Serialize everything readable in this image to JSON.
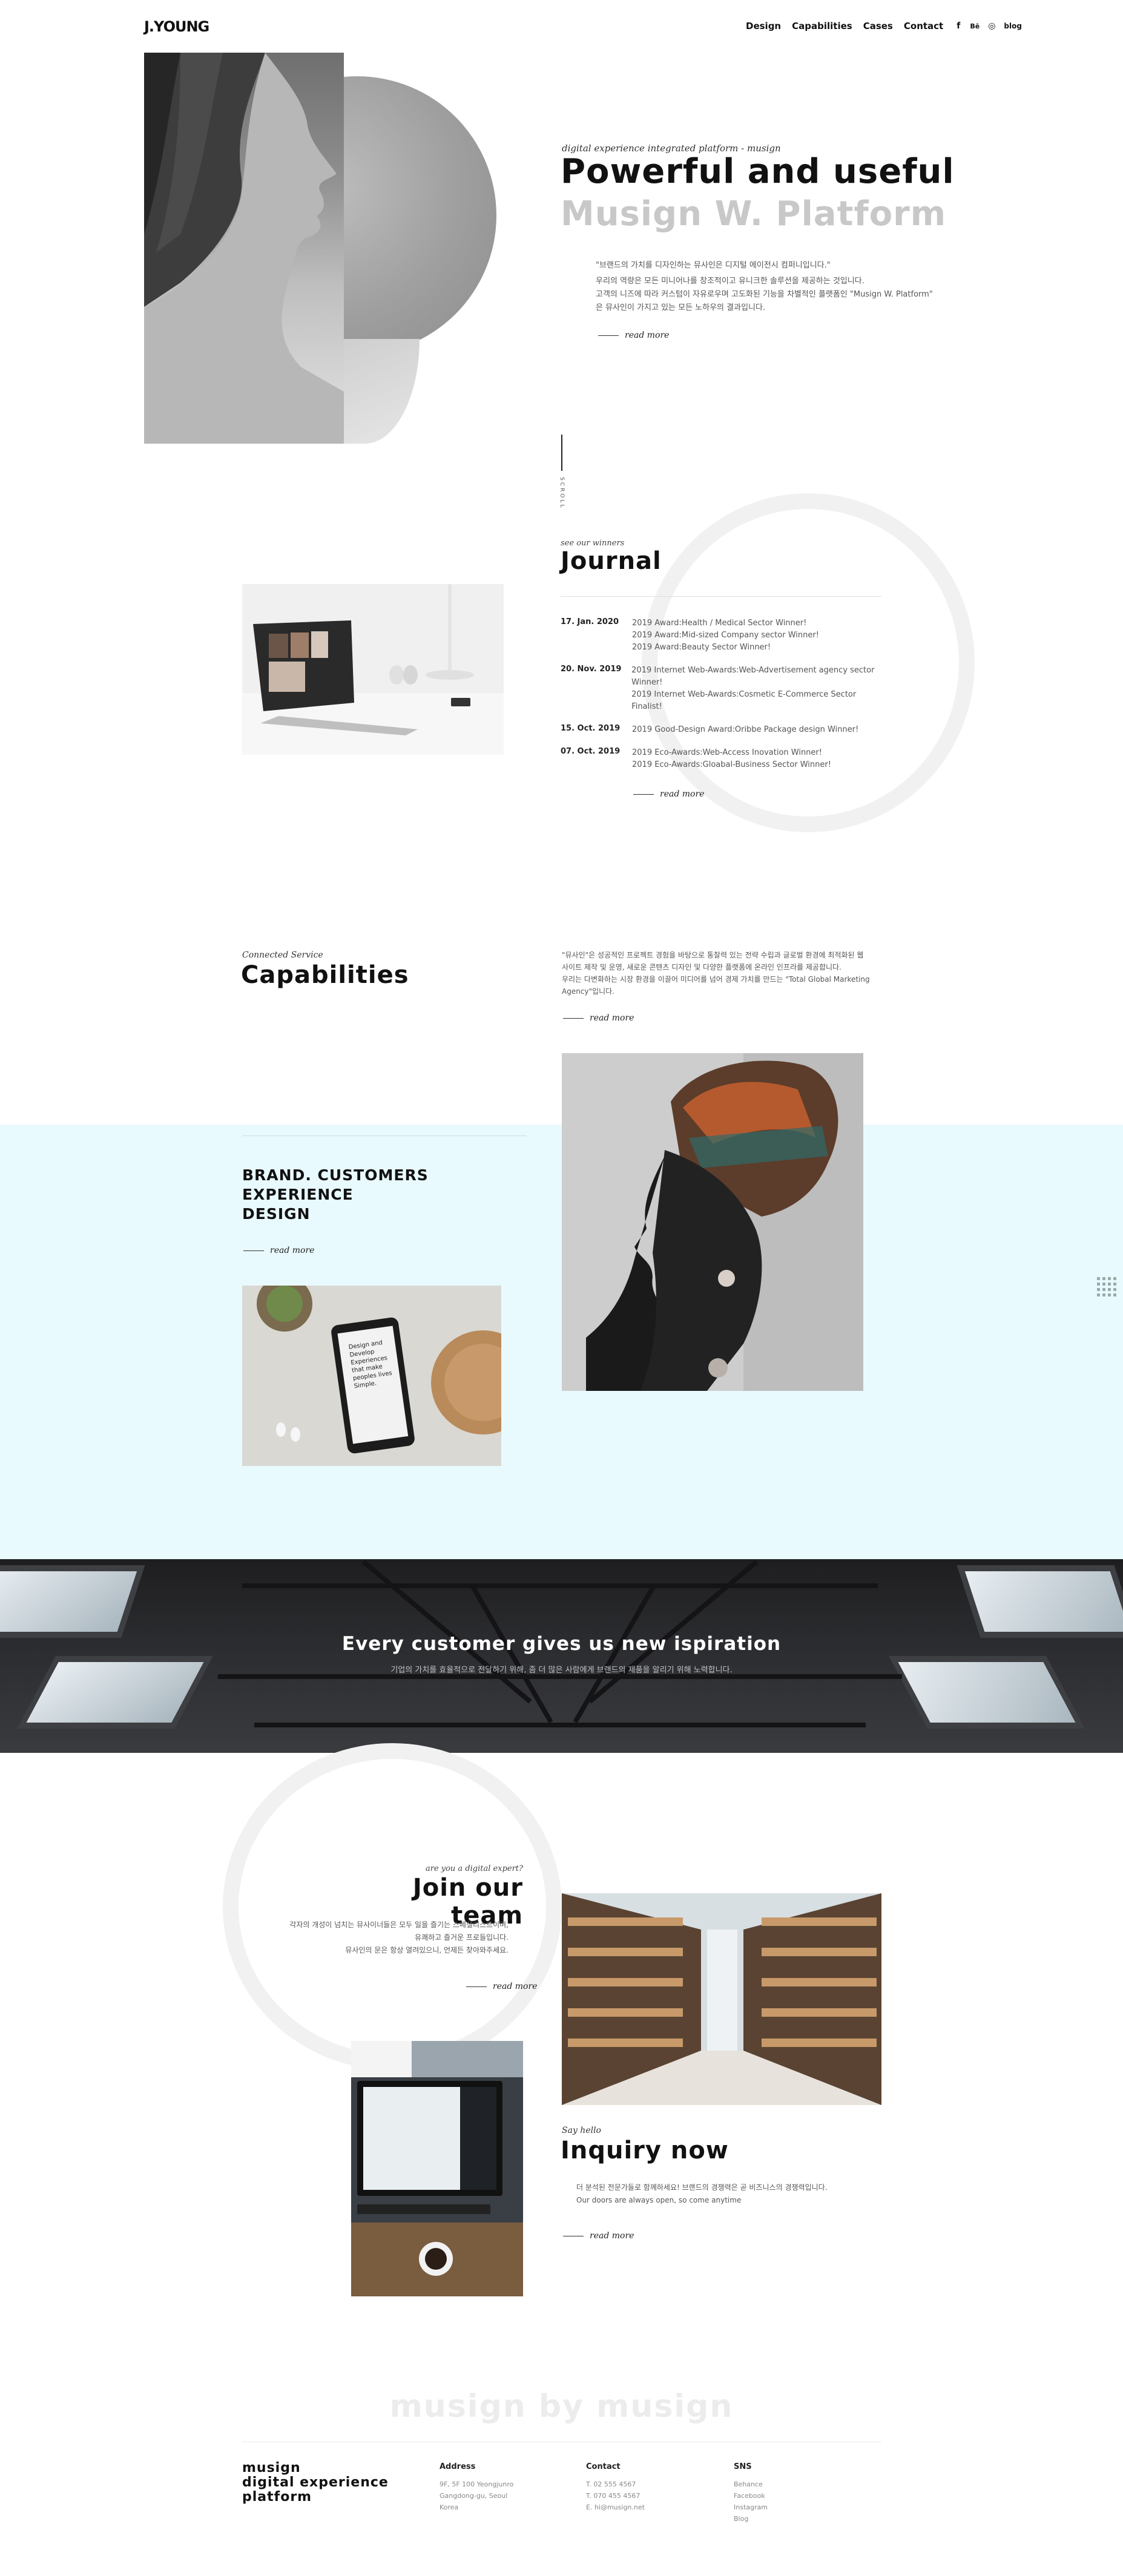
{
  "header": {
    "logo": "J.YOUNG",
    "nav": [
      "Design",
      "Capabilities",
      "Cases",
      "Contact"
    ],
    "social": [
      "f",
      "Bē",
      "◎",
      "blog"
    ]
  },
  "hero": {
    "tagline": "digital experience integrated platform - musign",
    "title_line1": "Powerful and useful",
    "title_line2": "Musign W. Platform",
    "paragraph": [
      "\"브랜드의 가치를 디자인하는 뮤사인은 디지털 에이전시 컴퍼니입니다.\"",
      "우리의 역량은 모든 미니어나를 창조적이고 유니크한 솔루션을 제공하는 것입니다.",
      "고객의 니즈에 따라 커스텀이 자유로우며 고도화된 기능을 차별적인 플랫폼인 \"Musign W. Platform\"",
      "은 뮤사인이 가지고 있는 모든 노하우의 결과입니다."
    ],
    "readmore": "read more",
    "scroll": "SCROLL"
  },
  "journal": {
    "subtitle": "see our winners",
    "title": "Journal",
    "entries": [
      {
        "date": "17. Jan. 2020",
        "lines": [
          "2019 Award:Health / Medical Sector Winner!",
          "2019 Award:Mid-sized Company sector Winner!",
          "2019 Award:Beauty Sector Winner!"
        ]
      },
      {
        "date": "20. Nov. 2019",
        "lines": [
          "2019 Internet Web-Awards:Web-Advertisement agency sector",
          "Winner!",
          "2019 Internet Web-Awards:Cosmetic E-Commerce Sector Finalist!"
        ]
      },
      {
        "date": "15. Oct. 2019",
        "lines": [
          "2019 Good-Design Award:Oribbe Package design Winner!"
        ]
      },
      {
        "date": "07. Oct. 2019",
        "lines": [
          "2019 Eco-Awards:Web-Access Inovation Winner!",
          "2019 Eco-Awards:Gloabal-Business Sector Winner!"
        ]
      }
    ],
    "readmore": "read more"
  },
  "capabilities": {
    "subtitle": "Connected Service",
    "title": "Capabilities",
    "paragraph": [
      "\"뮤사인\"은 성공적인 프로젝트 경험을 바탕으로 통찰력 있는 전략 수립과 글로벌 환경에 최적화된 웹",
      "사이트 제작 및 운영, 새로운 콘텐츠 디자인 및 다양한 플랫폼에 온라인 인프라를 제공합니다.",
      "우리는 다변화하는 시장 환경을 이끌어 미디어를 넘어 경제 가치를 만드는 \"Total Global Marketing",
      "Agency\"입니다."
    ],
    "readmore": "read more",
    "brand_lines": [
      "BRAND. CUSTOMERS",
      "EXPERIENCE",
      "DESIGN"
    ],
    "brand_readmore": "read more",
    "phone_text": "Design and Develop Experiences that make peoples lives Simple."
  },
  "banner": {
    "title": "Every customer gives us new ispiration",
    "subtitle": "기업의 가치를 효율적으로 전달하기 위해, 좀 더 많은 사람에게 브랜드의 제품을 알리기 위해 노력합니다."
  },
  "team": {
    "subtitle": "are you a digital expert?",
    "title": "Join our team",
    "paragraph": [
      "각자의 개성이 넘치는 뮤사이너들은 모두 일을 즐기는 스페셜리스트이며,",
      "유쾌하고 즐거운 프로들입니다.",
      "뮤사인의 문은 항상 열려있으니, 언제든 찾아와주세요."
    ],
    "readmore": "read more"
  },
  "inquiry": {
    "subtitle": "Say hello",
    "title": "Inquiry now",
    "paragraph": [
      "더 분석된 전문가들로 함께하세요! 브랜드의 경쟁력은 곧 비즈니스의 경쟁력입니다.",
      "Our doors are always open, so come anytime"
    ],
    "readmore": "read more"
  },
  "footer": {
    "watermark": "musign by musign",
    "brand": [
      "musign",
      "digital experience",
      "platform"
    ],
    "address": {
      "heading": "Address",
      "lines": [
        "9F, 5F 100 Yeongjunro",
        "Gangdong-gu, Seoul",
        "Korea"
      ]
    },
    "contact": {
      "heading": "Contact",
      "lines": [
        "T. 02 555 4567",
        "T. 070 455 4567",
        "E. hi@musign.net"
      ]
    },
    "sns": {
      "heading": "SNS",
      "lines": [
        "Behance",
        "Facebook",
        "Instagram",
        "Blog"
      ]
    }
  },
  "colors": {
    "accent_band": "#e9fafe",
    "dark_band": "#2a2b2e",
    "muted_title": "#c8c8c8"
  }
}
